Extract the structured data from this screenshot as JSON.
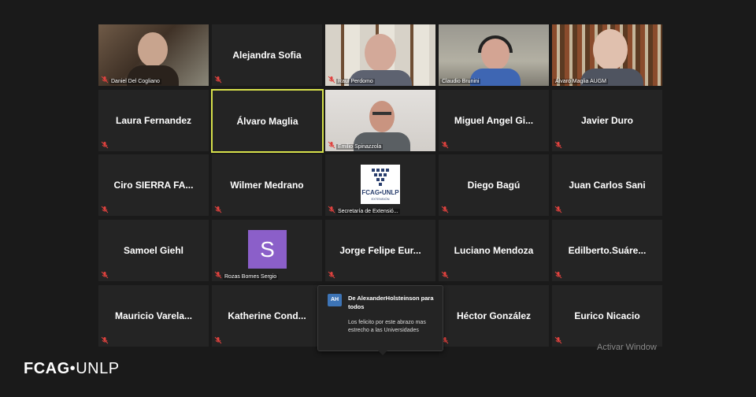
{
  "participants": [
    {
      "name": "Daniel Del Cogliano",
      "video": true
    },
    {
      "name": "Alejandra Sofia",
      "video": false
    },
    {
      "name": "Raul Perdomo",
      "video": true
    },
    {
      "name": "Claudio Brunini",
      "video": true
    },
    {
      "name": "Álvaro Maglia AUGM",
      "video": true
    },
    {
      "name": "Laura Fernandez",
      "video": false
    },
    {
      "name": "Álvaro Maglia",
      "video": false,
      "active_speaker": true
    },
    {
      "name": "Emilio Spinazzola",
      "video": true
    },
    {
      "name": "Miguel Angel Gi...",
      "video": false
    },
    {
      "name": "Javier Duro",
      "video": false
    },
    {
      "name": "Ciro SIERRA FA...",
      "video": false
    },
    {
      "name": "Wilmer Medrano",
      "video": false
    },
    {
      "name": "Secretaría de Extensió...",
      "video": true
    },
    {
      "name": "Diego Bagú",
      "video": false
    },
    {
      "name": "Juan Carlos Sani",
      "video": false
    },
    {
      "name": "Samoel Giehl",
      "video": false
    },
    {
      "name": "Rozas Bornes Sergio",
      "video": true
    },
    {
      "name": "Jorge Felipe Eur...",
      "video": false
    },
    {
      "name": "Luciano Mendoza",
      "video": false
    },
    {
      "name": "Edilberto.Suáre...",
      "video": false
    },
    {
      "name": "Mauricio Varela...",
      "video": false
    },
    {
      "name": "Katherine Cond...",
      "video": false
    },
    {
      "name": "",
      "video": false
    },
    {
      "name": "Héctor González",
      "video": false
    },
    {
      "name": "Eurico Nicacio",
      "video": false
    }
  ],
  "avatar_letter": "S",
  "tile_logo": {
    "text": "FCAG•UNLP",
    "sub": "EXTENSIÓN"
  },
  "chat": {
    "initials": "AH",
    "from": "De AlexanderHolsteinson para todos",
    "message": "Los felicito por este abrazo mas estrecho a las Universidades"
  },
  "watermark": "Activar Window",
  "logo": {
    "bold": "FCAG",
    "sep": "•",
    "rest": "UNLP"
  },
  "colors": {
    "background": "#1a1a1a",
    "tile": "#242424",
    "active_border": "#d6e04a",
    "muted_icon": "#e0423e",
    "avatar_purple": "#8b5fc9"
  }
}
